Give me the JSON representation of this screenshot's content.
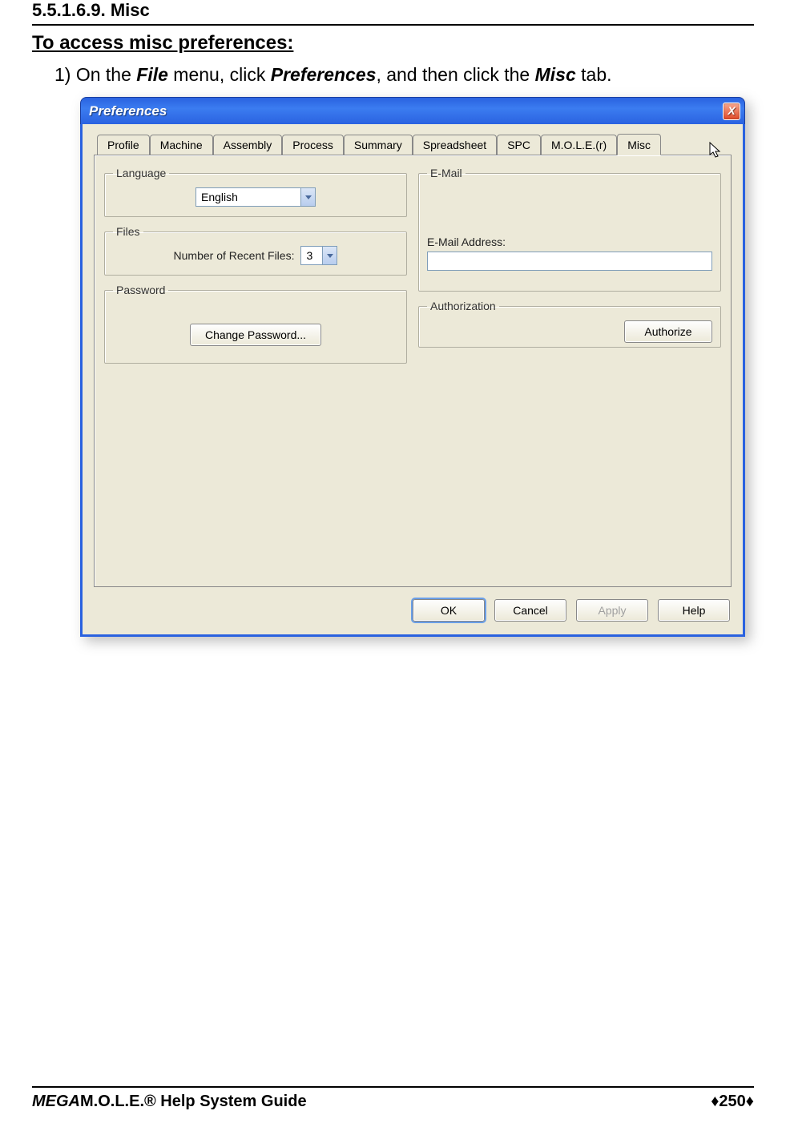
{
  "doc": {
    "heading": "5.5.1.6.9. Misc",
    "subheading": "To access misc preferences:",
    "instr_prefix": "1) On the ",
    "instr_file": "File",
    "instr_mid1": " menu, click ",
    "instr_pref": "Preferences",
    "instr_mid2": ", and then click the ",
    "instr_misc": "Misc",
    "instr_suffix": " tab."
  },
  "dialog": {
    "title": "Preferences",
    "close": "X",
    "tabs": [
      "Profile",
      "Machine",
      "Assembly",
      "Process",
      "Summary",
      "Spreadsheet",
      "SPC",
      "M.O.L.E.(r)",
      "Misc"
    ],
    "active_tab_index": 8,
    "language": {
      "legend": "Language",
      "value": "English"
    },
    "files": {
      "legend": "Files",
      "label": "Number of Recent Files:",
      "value": "3"
    },
    "password": {
      "legend": "Password",
      "button": "Change Password..."
    },
    "email": {
      "legend": "E-Mail",
      "label": "E-Mail Address:",
      "value": ""
    },
    "authorization": {
      "legend": "Authorization",
      "button": "Authorize"
    },
    "buttons": {
      "ok": "OK",
      "cancel": "Cancel",
      "apply": "Apply",
      "help": "Help"
    }
  },
  "footer": {
    "guide_pre": "MEGA",
    "guide_rest": "M.O.L.E.® Help System Guide",
    "page": "250",
    "diamond": "♦"
  }
}
